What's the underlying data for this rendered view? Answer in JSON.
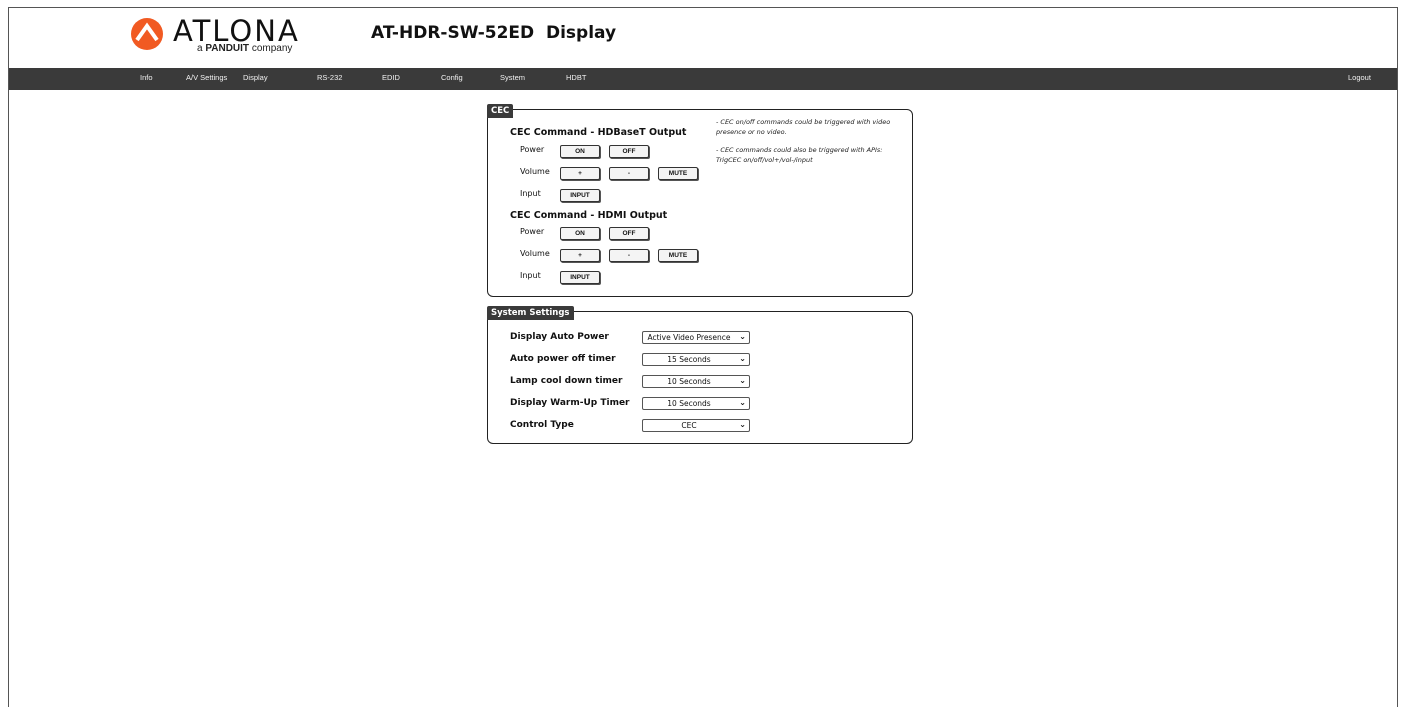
{
  "header": {
    "logo_text": "ATLONA",
    "logo_sub_prefix": "a",
    "logo_sub_brand": "PANDUIT",
    "logo_sub_suffix": "company",
    "title": "AT-HDR-SW-52ED  Display"
  },
  "nav": {
    "items": [
      "Info",
      "A/V Settings",
      "Display",
      "RS-232",
      "EDID",
      "Config",
      "System",
      "HDBT"
    ],
    "logout": "Logout"
  },
  "cec": {
    "tag": "CEC",
    "hdbaset": {
      "title": "CEC Command - HDBaseT Output",
      "power_label": "Power",
      "on": "ON",
      "off": "OFF",
      "volume_label": "Volume",
      "vol_up": "+",
      "vol_down": "-",
      "mute": "MUTE",
      "input_label": "Input",
      "input": "INPUT"
    },
    "hdmi": {
      "title": "CEC Command - HDMI Output",
      "power_label": "Power",
      "on": "ON",
      "off": "OFF",
      "volume_label": "Volume",
      "vol_up": "+",
      "vol_down": "-",
      "mute": "MUTE",
      "input_label": "Input",
      "input": "INPUT"
    },
    "note_1": "- CEC on/off commands could be triggered with video presence or no video.",
    "note_2": "- CEC commands could also be triggered with APIs: TrigCEC on/off/vol+/vol-/input"
  },
  "system": {
    "tag": "System Settings",
    "rows": [
      {
        "label": "Display Auto Power",
        "value": "Active Video Presence"
      },
      {
        "label": "Auto power off timer",
        "value": "15 Seconds"
      },
      {
        "label": "Lamp cool down timer",
        "value": "10 Seconds"
      },
      {
        "label": "Display Warm-Up Timer",
        "value": "10 Seconds"
      },
      {
        "label": "Control Type",
        "value": "CEC"
      }
    ]
  },
  "colors": {
    "navbar": "#3a3a3a",
    "logo_orange": "#f15a22"
  }
}
